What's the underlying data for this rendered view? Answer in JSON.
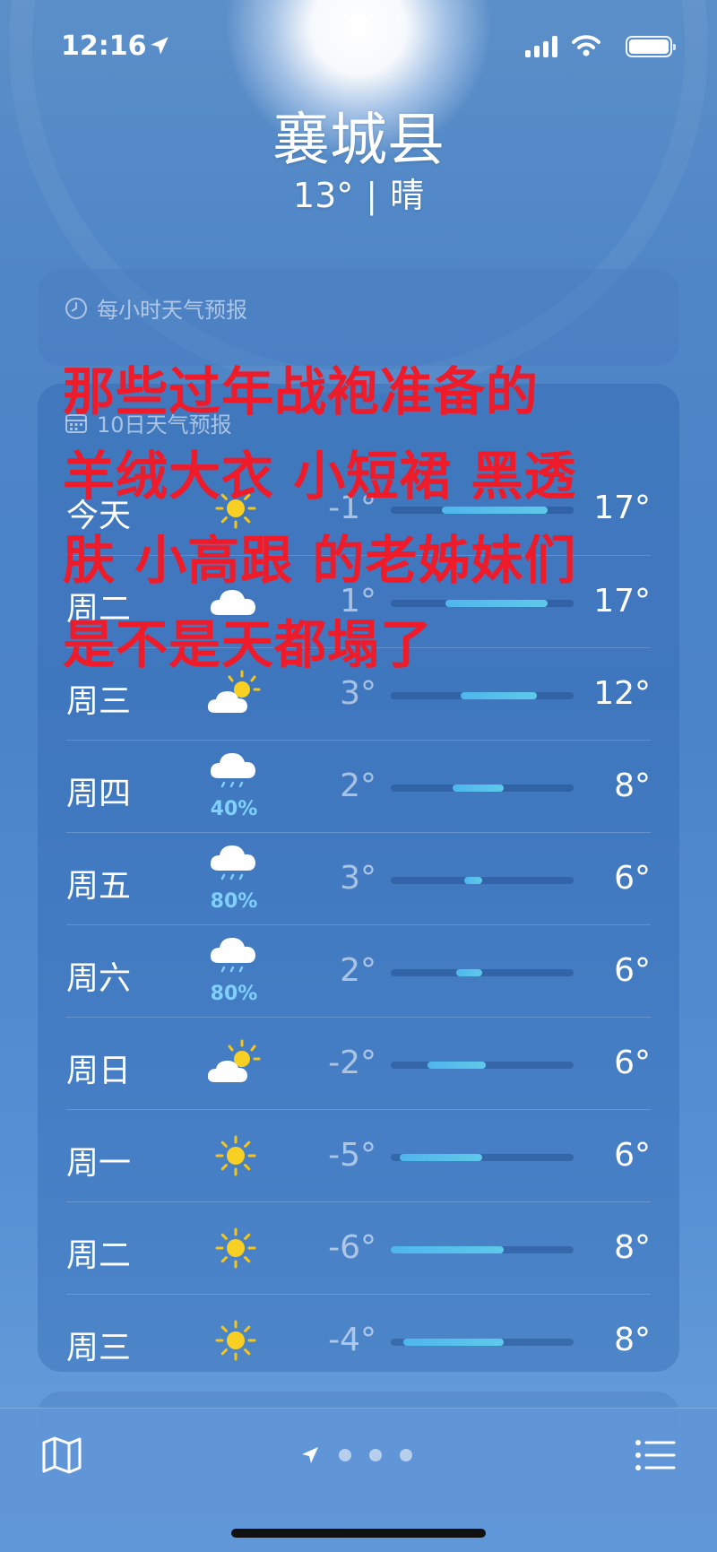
{
  "status_bar": {
    "time": "12:16",
    "icons": [
      "location-arrow-icon",
      "cellular-signal-icon",
      "wifi-icon",
      "battery-icon"
    ]
  },
  "location": {
    "city": "襄城县",
    "temperature": "13°",
    "separator": "|",
    "condition": "晴"
  },
  "hourly": {
    "title": "每小时天气预报",
    "icon": "clock-icon"
  },
  "ten_day": {
    "title": "10日天气预报",
    "icon": "calendar-icon",
    "days": [
      {
        "day": "今天",
        "icon": "sun-icon",
        "low": "-1°",
        "high": "17°",
        "bar_start": 0.28,
        "bar_end": 0.86
      },
      {
        "day": "周二",
        "icon": "cloud-icon",
        "low": "1°",
        "high": "17°",
        "bar_start": 0.3,
        "bar_end": 0.86
      },
      {
        "day": "周三",
        "icon": "partly-cloudy-icon",
        "low": "3°",
        "high": "12°",
        "bar_start": 0.38,
        "bar_end": 0.8
      },
      {
        "day": "周四",
        "icon": "rain-cloud-icon",
        "pop": "40%",
        "low": "2°",
        "high": "8°",
        "bar_start": 0.34,
        "bar_end": 0.62
      },
      {
        "day": "周五",
        "icon": "rain-cloud-icon",
        "pop": "80%",
        "low": "3°",
        "high": "6°",
        "bar_start": 0.4,
        "bar_end": 0.5
      },
      {
        "day": "周六",
        "icon": "rain-cloud-icon",
        "pop": "80%",
        "low": "2°",
        "high": "6°",
        "bar_start": 0.36,
        "bar_end": 0.5
      },
      {
        "day": "周日",
        "icon": "partly-cloudy-icon",
        "low": "-2°",
        "high": "6°",
        "bar_start": 0.2,
        "bar_end": 0.52
      },
      {
        "day": "周一",
        "icon": "sun-icon",
        "low": "-5°",
        "high": "6°",
        "bar_start": 0.05,
        "bar_end": 0.5
      },
      {
        "day": "周二",
        "icon": "sun-icon",
        "low": "-6°",
        "high": "8°",
        "bar_start": 0.0,
        "bar_end": 0.62
      },
      {
        "day": "周三",
        "icon": "sun-icon",
        "low": "-4°",
        "high": "8°",
        "bar_start": 0.07,
        "bar_end": 0.62
      }
    ]
  },
  "overlay_caption": {
    "lines": [
      "那些过年战袍准备的",
      "羊绒大衣 小短裙 黑透",
      "肤 小高跟 的老姊妹们",
      "是不是天都塌了"
    ],
    "color": "#ee1b2a"
  },
  "toolbar": {
    "map_icon": "map-icon",
    "location_icon": "location-arrow-icon",
    "page_dots": 3,
    "list_icon": "list-icon"
  },
  "colors": {
    "background": "#4f86c7",
    "temp_bar": "#4fb6ec",
    "precip": "#7fd0ff"
  }
}
